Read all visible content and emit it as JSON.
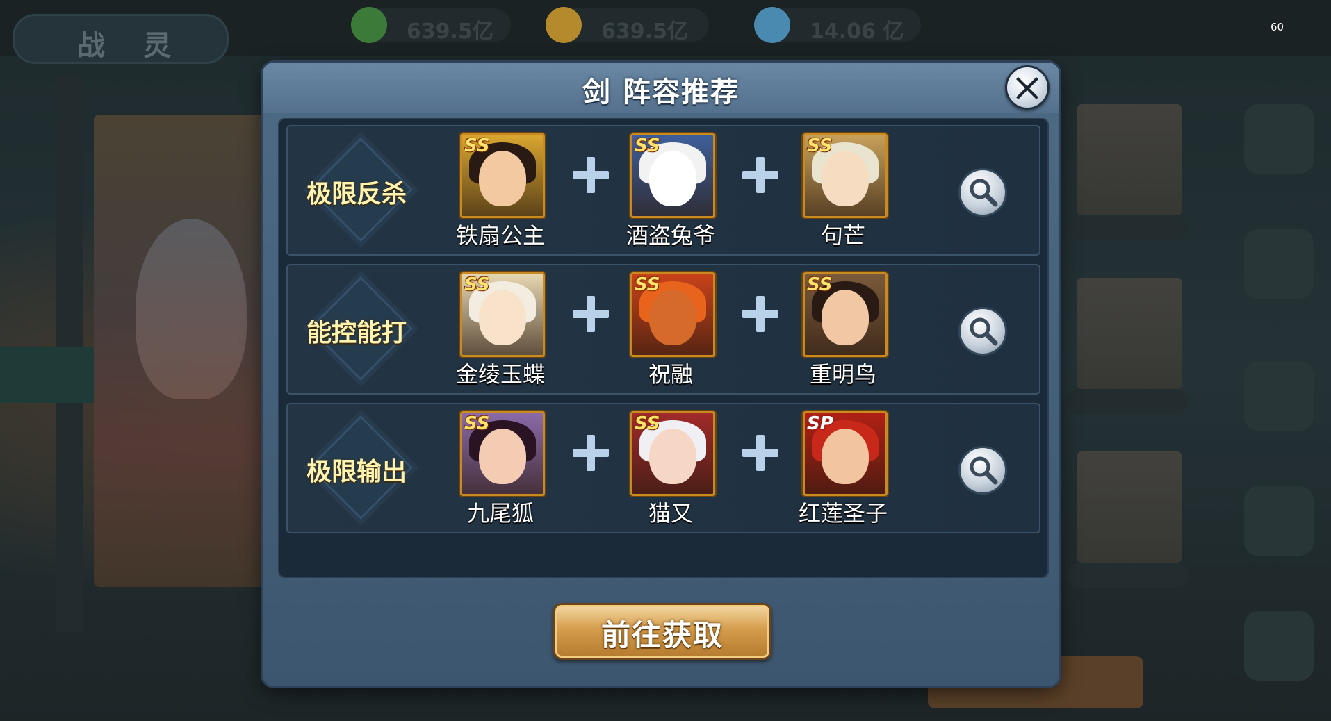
{
  "background": {
    "back_chars": [
      "战",
      "灵"
    ],
    "resources": [
      {
        "icon": "jade-icon",
        "value": "639.5亿",
        "color": "#3c7a3a"
      },
      {
        "icon": "gold-ingot-icon",
        "value": "639.5亿",
        "color": "#b58a2c"
      },
      {
        "icon": "crystal-icon",
        "value": "14.06 亿",
        "color": "#4a8ab0"
      }
    ],
    "fps": "60"
  },
  "dialog": {
    "title": "剑 阵容推荐",
    "close_icon": "close-icon",
    "search_icon": "magnifier-icon",
    "action_label": "前往获取",
    "rows": [
      {
        "label": "极限反杀",
        "heroes": [
          {
            "rank": "SS",
            "name": "铁扇公主",
            "hair": "#2a1a14",
            "face": "#f3c9a2",
            "bg": "#d9a630"
          },
          {
            "rank": "SS",
            "name": "酒盗兔爷",
            "hair": "#f2f2f2",
            "face": "#ffffff",
            "bg": "#3f5f9a"
          },
          {
            "rank": "SS",
            "name": "句芒",
            "hair": "#e8e4d0",
            "face": "#f6dcc0",
            "bg": "#c7a05a"
          }
        ]
      },
      {
        "label": "能控能打",
        "heroes": [
          {
            "rank": "SS",
            "name": "金绫玉蝶",
            "hair": "#f2ede0",
            "face": "#f8e2ca",
            "bg": "#e6d6b0"
          },
          {
            "rank": "SS",
            "name": "祝融",
            "hair": "#e8641c",
            "face": "#d56a2a",
            "bg": "#c8421a"
          },
          {
            "rank": "SS",
            "name": "重明鸟",
            "hair": "#2a1a14",
            "face": "#f2c8a4",
            "bg": "#7a5a3a"
          }
        ]
      },
      {
        "label": "极限输出",
        "heroes": [
          {
            "rank": "SS",
            "name": "九尾狐",
            "hair": "#2a1424",
            "face": "#f4ccb4",
            "bg": "#8a6aa8"
          },
          {
            "rank": "SS",
            "name": "猫又",
            "hair": "#f0f0f4",
            "face": "#f6d6c4",
            "bg": "#a02a2a"
          },
          {
            "rank": "SP",
            "name": "红莲圣子",
            "hair": "#c8281a",
            "face": "#f2c4a0",
            "bg": "#b02014"
          }
        ]
      }
    ]
  }
}
